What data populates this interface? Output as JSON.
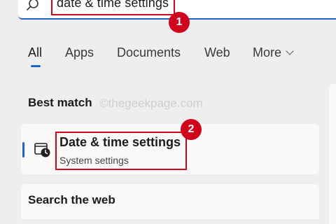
{
  "search": {
    "value": "date & time settings"
  },
  "tabs": [
    {
      "label": "All",
      "active": true
    },
    {
      "label": "Apps"
    },
    {
      "label": "Documents"
    },
    {
      "label": "Web"
    },
    {
      "label": "More"
    }
  ],
  "best_match": {
    "heading": "Best match",
    "watermark": "©thegeekpage.com",
    "result": {
      "title": "Date & time settings",
      "subtitle": "System settings",
      "icon": "clock-settings-icon"
    }
  },
  "search_web": {
    "heading": "Search the web"
  },
  "annotations": [
    {
      "number": "1",
      "color": "#d0021b"
    },
    {
      "number": "2",
      "color": "#d0021b"
    }
  ],
  "colors": {
    "accent": "#1f63c4",
    "annotation": "#d0021b"
  }
}
